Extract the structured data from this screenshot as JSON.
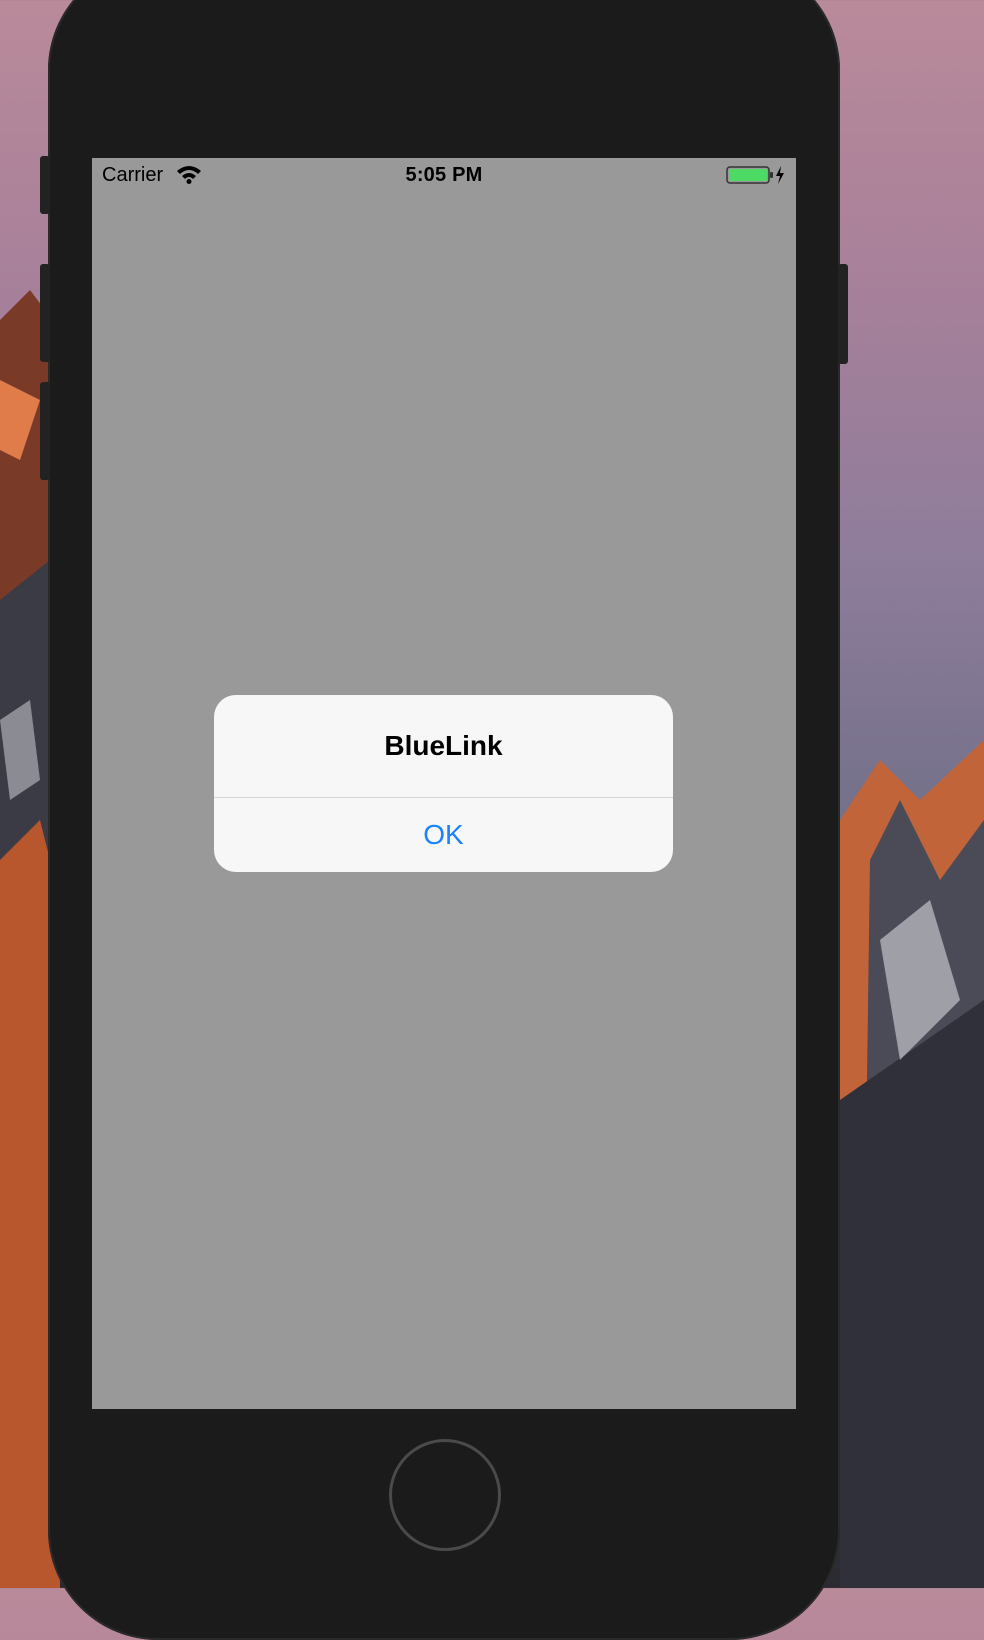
{
  "status_bar": {
    "carrier": "Carrier",
    "time": "5:05 PM",
    "wifi_icon": "wifi-icon",
    "battery_icon": "battery-charging-icon"
  },
  "alert": {
    "title": "BlueLink",
    "ok_label": "OK"
  },
  "colors": {
    "accent": "#1a82fb",
    "screen_background": "#999999",
    "device_body": "#1b1b1c",
    "battery_fill": "#4cd964"
  }
}
